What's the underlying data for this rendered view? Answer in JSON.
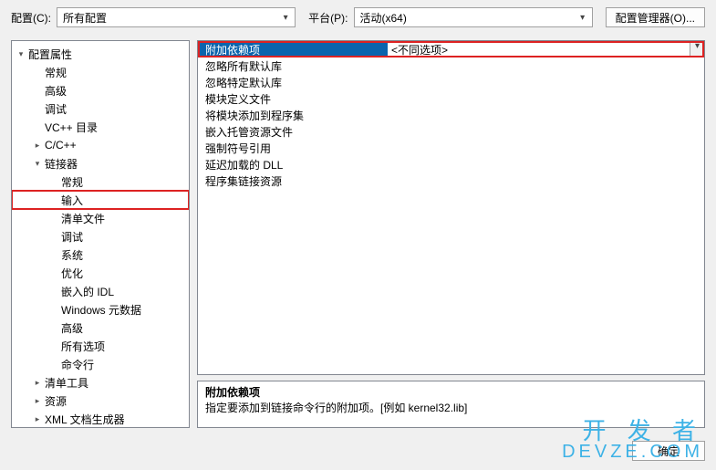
{
  "top": {
    "config_label": "配置(C):",
    "config_value": "所有配置",
    "platform_label": "平台(P):",
    "platform_value": "活动(x64)",
    "config_mgr": "配置管理器(O)..."
  },
  "tree": [
    {
      "label": "配置属性",
      "depth": 0,
      "expander": "open"
    },
    {
      "label": "常规",
      "depth": 1,
      "expander": "none"
    },
    {
      "label": "高级",
      "depth": 1,
      "expander": "none"
    },
    {
      "label": "调试",
      "depth": 1,
      "expander": "none"
    },
    {
      "label": "VC++ 目录",
      "depth": 1,
      "expander": "none"
    },
    {
      "label": "C/C++",
      "depth": 1,
      "expander": "closed"
    },
    {
      "label": "链接器",
      "depth": 1,
      "expander": "open"
    },
    {
      "label": "常规",
      "depth": 2,
      "expander": "none"
    },
    {
      "label": "输入",
      "depth": 2,
      "expander": "none",
      "selected": true
    },
    {
      "label": "清单文件",
      "depth": 2,
      "expander": "none"
    },
    {
      "label": "调试",
      "depth": 2,
      "expander": "none"
    },
    {
      "label": "系统",
      "depth": 2,
      "expander": "none"
    },
    {
      "label": "优化",
      "depth": 2,
      "expander": "none"
    },
    {
      "label": "嵌入的 IDL",
      "depth": 2,
      "expander": "none"
    },
    {
      "label": "Windows 元数据",
      "depth": 2,
      "expander": "none"
    },
    {
      "label": "高级",
      "depth": 2,
      "expander": "none"
    },
    {
      "label": "所有选项",
      "depth": 2,
      "expander": "none"
    },
    {
      "label": "命令行",
      "depth": 2,
      "expander": "none"
    },
    {
      "label": "清单工具",
      "depth": 1,
      "expander": "closed"
    },
    {
      "label": "资源",
      "depth": 1,
      "expander": "closed"
    },
    {
      "label": "XML 文档生成器",
      "depth": 1,
      "expander": "closed"
    }
  ],
  "grid": [
    {
      "name": "附加依赖项",
      "value": "<不同选项>",
      "selected": true
    },
    {
      "name": "忽略所有默认库",
      "value": ""
    },
    {
      "name": "忽略特定默认库",
      "value": ""
    },
    {
      "name": "模块定义文件",
      "value": ""
    },
    {
      "name": "将模块添加到程序集",
      "value": ""
    },
    {
      "name": "嵌入托管资源文件",
      "value": ""
    },
    {
      "name": "强制符号引用",
      "value": ""
    },
    {
      "name": "延迟加载的 DLL",
      "value": ""
    },
    {
      "name": "程序集链接资源",
      "value": ""
    }
  ],
  "desc": {
    "title": "附加依赖项",
    "body": "指定要添加到链接命令行的附加项。[例如 kernel32.lib]"
  },
  "buttons": {
    "ok": "确定"
  },
  "watermark": {
    "cn": "开 发 者",
    "en": "DEVZE.COM"
  }
}
